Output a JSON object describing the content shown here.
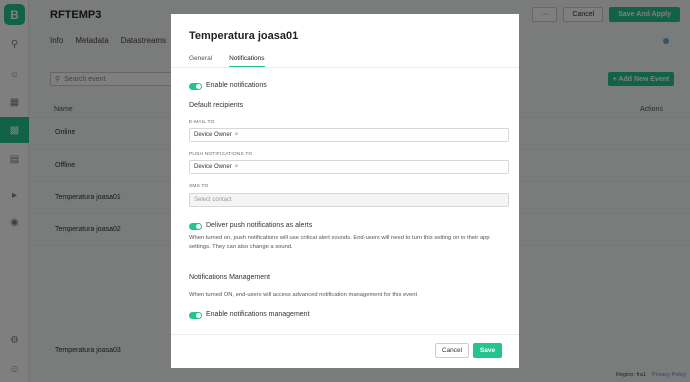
{
  "app": {
    "logo_letter": "B",
    "title": "RFTEMP3",
    "tabs": [
      "Info",
      "Metadata",
      "Datastreams"
    ],
    "more_label": "···",
    "cancel_label": "Cancel",
    "save_apply_label": "Save And Apply"
  },
  "events": {
    "search_placeholder": "Search event",
    "add_button": "+ Add New Event",
    "col_name": "Name",
    "col_actions": "Actions",
    "rows": [
      "Online",
      "Offline",
      "Temperatura joasa01",
      "Temperatura joasa02",
      "Temperatura joasa03"
    ]
  },
  "footer": {
    "region": "Region: fra1",
    "privacy": "Privacy Policy"
  },
  "sidebar": {
    "icons": [
      "search-icon",
      "sun-icon",
      "device-grid-icon",
      "apps-icon",
      "building-icon",
      "megaphone-icon",
      "lifebuoy-icon",
      "settings-icon",
      "user-icon"
    ]
  },
  "modal": {
    "title": "Temperatura joasa01",
    "tabs": [
      "General",
      "Notifications"
    ],
    "enable_notifications": "Enable notifications",
    "default_recipients": "Default recipients",
    "email_label": "E-MAIL TO",
    "email_chip": "Device Owner",
    "push_label": "PUSH NOTIFICATIONS TO",
    "push_chip": "Device Owner",
    "sms_label": "SMS TO",
    "sms_placeholder": "Select contact",
    "deliver_alerts": "Deliver push notifications as alerts",
    "deliver_desc": "When turned on, push notifications will use critical alert sounds. End-users will need to turn this setting on in their app settings. They can also change a sound.",
    "mgmt_title": "Notifications Management",
    "mgmt_desc": "When turned ON, end-users will access advanced notification management for this event",
    "enable_mgmt": "Enable notifications management",
    "cancel": "Cancel",
    "save": "Save"
  },
  "colors": {
    "accent": "#23c48e",
    "overlay": "rgba(0,0,0,0.5)"
  }
}
